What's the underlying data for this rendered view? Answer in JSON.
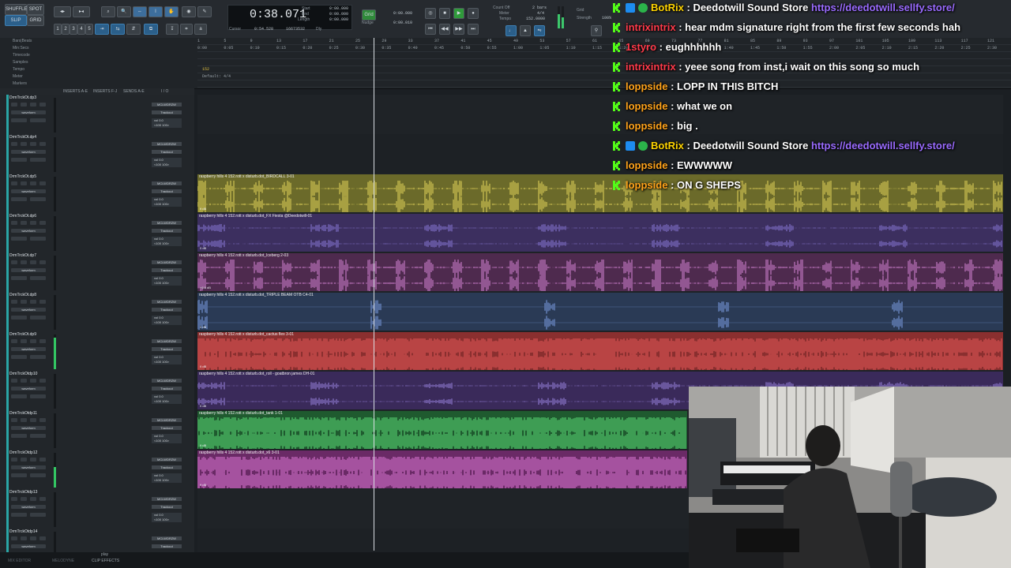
{
  "transport": {
    "modes": [
      "SHUFFLE",
      "SPOT",
      "SLIP",
      "GRID"
    ],
    "counter_main": "0:38.071",
    "cursor_label": "Cursor",
    "cursor_value": "0:54.528",
    "cursor_value2": "16673532",
    "start_label": "Start",
    "end_label": "End",
    "length_label": "Length",
    "start_value": "0:00.000",
    "end_value": "0:00.000",
    "length_value": "0:00.000",
    "nudge_label": "Nudge",
    "nudge_value": "0:00.010",
    "grid_value": "0:00.000",
    "grid_label": "Grid",
    "strength_label": "Strength",
    "strength_value": "100%",
    "swing_label": "Swing",
    "swing_value": "100%",
    "countoff_label": "Count Off",
    "countoff_value": "2 bars",
    "meter_label": "Meter",
    "meter_value": "4/4",
    "tempo_label": "Tempo",
    "tempo_value": "152.0000",
    "dly_label": "Dly"
  },
  "rulers": {
    "labels": [
      "Bars|Beats",
      "Min:Secs",
      "Timecode",
      "Samples",
      "Tempo",
      "Meter",
      "Markers"
    ],
    "bar_ticks": [
      "1",
      "5",
      "9",
      "13",
      "17",
      "21",
      "25",
      "29",
      "33",
      "37",
      "41",
      "45",
      "49",
      "53",
      "57",
      "61",
      "65",
      "69",
      "73",
      "77",
      "81",
      "85",
      "89",
      "93",
      "97",
      "101",
      "105",
      "109",
      "113",
      "117",
      "121"
    ],
    "min_ticks": [
      "0:00",
      "0:05",
      "0:10",
      "0:15",
      "0:20",
      "0:25",
      "0:30",
      "0:35",
      "0:40",
      "0:45",
      "0:50",
      "0:55",
      "1:00",
      "1:05",
      "1:10",
      "1:15",
      "1:20",
      "1:25",
      "1:30",
      "1:35",
      "1:40",
      "1:45",
      "1:50",
      "1:55",
      "2:00",
      "2:05",
      "2:10",
      "2:15",
      "2:20",
      "2:25",
      "2:30"
    ],
    "tempo_marker": "152",
    "meter_marker": "Default: 4/4"
  },
  "mix_header": {
    "inserts_ae": "INSERTS A-E",
    "inserts_fj": "INSERTS F-J",
    "sends_ae": "SENDS A-E",
    "io": "I / O"
  },
  "tracks": [
    {
      "name": "DrmTrckOt.dp3",
      "io": "MCLWDRZW",
      "io2": "Trackout",
      "vol": "vol 0.0",
      "pan": "<100 100>",
      "view": "waveform",
      "level": 0
    },
    {
      "name": "DrmTrckOt.dp4",
      "io": "MCLWDRZW",
      "io2": "Trackout",
      "vol": "vol 0.0",
      "pan": "<100 100>",
      "view": "waveform",
      "level": 0
    },
    {
      "name": "DrmTrckOt.dp5",
      "io": "MCLWDRZW",
      "io2": "Trackout",
      "vol": "vol 0.0",
      "pan": "<100 100>",
      "view": "waveform",
      "level": 0
    },
    {
      "name": "DrmTrckOt.dp6",
      "io": "MCLWDRZW",
      "io2": "Trackout",
      "vol": "vol 0.0",
      "pan": "<100 100>",
      "view": "waveform",
      "level": 0
    },
    {
      "name": "DrmTrckOt.dp7",
      "io": "MCLWDRZW",
      "io2": "Trackout",
      "vol": "vol 0.0",
      "pan": "<100 100>",
      "view": "waveform",
      "level": 0
    },
    {
      "name": "DrmTrckOt.dp8",
      "io": "MCLWDRZW",
      "io2": "Trackout",
      "vol": "vol 0.0",
      "pan": "<100 100>",
      "view": "waveform",
      "level": 0
    },
    {
      "name": "DrmTrckOt.dp9",
      "io": "MCLWDRZW",
      "io2": "Trackout",
      "vol": "vol 0.0",
      "pan": "<100 100>",
      "view": "waveform",
      "level": 0.9
    },
    {
      "name": "DrmTrckOtdp10",
      "io": "MCLWDRZW",
      "io2": "Trackout",
      "vol": "vol 0.0",
      "pan": "<100 100>",
      "view": "waveform",
      "level": 0
    },
    {
      "name": "DrmTrckOtdp11",
      "io": "MCLWDRZW",
      "io2": "Trackout",
      "vol": "vol 0.0",
      "pan": "<100 100>",
      "view": "waveform",
      "level": 0
    },
    {
      "name": "DrmTrckOtdp12",
      "io": "MCLWDRZW",
      "io2": "Trackout",
      "vol": "vol 0.0",
      "pan": "<100 100>",
      "view": "waveform",
      "level": 0.6
    },
    {
      "name": "DrmTrckOtdp13",
      "io": "MCLWDRZW",
      "io2": "Trackout",
      "vol": "vol 0.0",
      "pan": "<100 100>",
      "view": "waveform",
      "level": 0
    },
    {
      "name": "DrmTrckOtdp14",
      "io": "MCLWDRZW",
      "io2": "Trackout",
      "vol": "vol 0.0",
      "pan": "<100 100>",
      "view": "waveform",
      "level": 0
    }
  ],
  "clips": [
    {
      "lane": 2,
      "title": "raspberry hills 4 152.rott x disturb.dot_BIRDCALL 3-01",
      "color": "#6b6a2a",
      "wave": "#e6d65a",
      "db": "0 dB",
      "start": 0,
      "end": 1020,
      "style": "bursts"
    },
    {
      "lane": 3,
      "title": "raspberry hills 4 152.rott x disturb.dot_FX Fiesta @Deedotwill-01",
      "color": "#3c2f5f",
      "wave": "#8a7ad8",
      "db": "0 dB",
      "start": 0,
      "end": 1020,
      "style": "sparse"
    },
    {
      "lane": 4,
      "title": "raspberry hills 4 152.rott x disturb.dot_Iceberg 2-03",
      "color": "#4e2a4e",
      "wave": "#d684d6",
      "db": "+6.8 dB",
      "start": 0,
      "end": 1020,
      "style": "bursts"
    },
    {
      "lane": 5,
      "title": "raspberry hills 4 152.rott x disturb.dot_TRIPLE BEAM OTB C4-01",
      "color": "#2a3a55",
      "wave": "#7ea0e8",
      "db": "0 dB",
      "start": 0,
      "end": 1020,
      "style": "rare"
    },
    {
      "lane": 6,
      "title": "raspberry hills 4 152.rott x disturb.dot_cactus flex 3-01",
      "color": "#8a2f2f",
      "wave": "#e85a5a",
      "db": "0 dB",
      "start": 0,
      "end": 1020,
      "style": "dense"
    },
    {
      "lane": 7,
      "title": "raspberry hills 4 152.rott x disturb.dot_roll - goatbron james DH-01",
      "color": "#3a2a5a",
      "wave": "#9a84e0",
      "db": "0 dB",
      "start": 0,
      "end": 1020,
      "style": "sparse"
    },
    {
      "lane": 8,
      "title": "raspberry hills 4 152.rott x disturb.dot_tank 1-01",
      "color": "#1f5a2f",
      "wave": "#5ee07a",
      "db": "0 dB",
      "start": 0,
      "end": 620,
      "style": "dense"
    },
    {
      "lane": 9,
      "title": "raspberry hills 4 152.rott x disturb.dot_x6 3-01",
      "color": "#6a2a66",
      "wave": "#e07ad8",
      "db": "0 dB",
      "start": 0,
      "end": 620,
      "style": "dense"
    }
  ],
  "chat": [
    {
      "badges": 3,
      "user": "BotRix",
      "user_color": "#ffd400",
      "text": " : Deedotwill Sound Store ",
      "link": "https://deedotwill.sellfy.store/"
    },
    {
      "badges": 1,
      "user": "intrixintrix",
      "user_color": "#ff3a4a",
      "text": " : hear mdm signature right from the first few seconds hah",
      "link": ""
    },
    {
      "badges": 1,
      "user": "1styro",
      "user_color": "#ff3a4a",
      "text": " : eughhhhhh",
      "link": ""
    },
    {
      "badges": 1,
      "user": "intrixintrix",
      "user_color": "#ff3a4a",
      "text": " : yeee song from inst,i wait on this song so much",
      "link": ""
    },
    {
      "badges": 1,
      "user": "loppside",
      "user_color": "#ffa31a",
      "text": " : LOPP IN THIS BITCH",
      "link": ""
    },
    {
      "badges": 1,
      "user": "loppside",
      "user_color": "#ffa31a",
      "text": " : what we on",
      "link": ""
    },
    {
      "badges": 1,
      "user": "loppside",
      "user_color": "#ffa31a",
      "text": " : big .",
      "link": ""
    },
    {
      "badges": 3,
      "user": "BotRix",
      "user_color": "#ffd400",
      "text": " : Deedotwill Sound Store ",
      "link": "https://deedotwill.sellfy.store/"
    },
    {
      "badges": 1,
      "user": "loppside",
      "user_color": "#ffa31a",
      "text": " : EWWWWW",
      "link": ""
    },
    {
      "badges": 1,
      "user": "loppside",
      "user_color": "#ffa31a",
      "text": " : ON G SHEPS",
      "link": ""
    }
  ],
  "bottom": {
    "tab1": "MIX EDITOR",
    "tab2": "MELODYNE",
    "tab3": "CLIP EFFECTS",
    "play": "play"
  },
  "colors": {
    "kick_badge": "#53fc18",
    "verified": "#1d8cf0",
    "track_color": "#2aa6a6",
    "playhead": "#d8dde2"
  }
}
